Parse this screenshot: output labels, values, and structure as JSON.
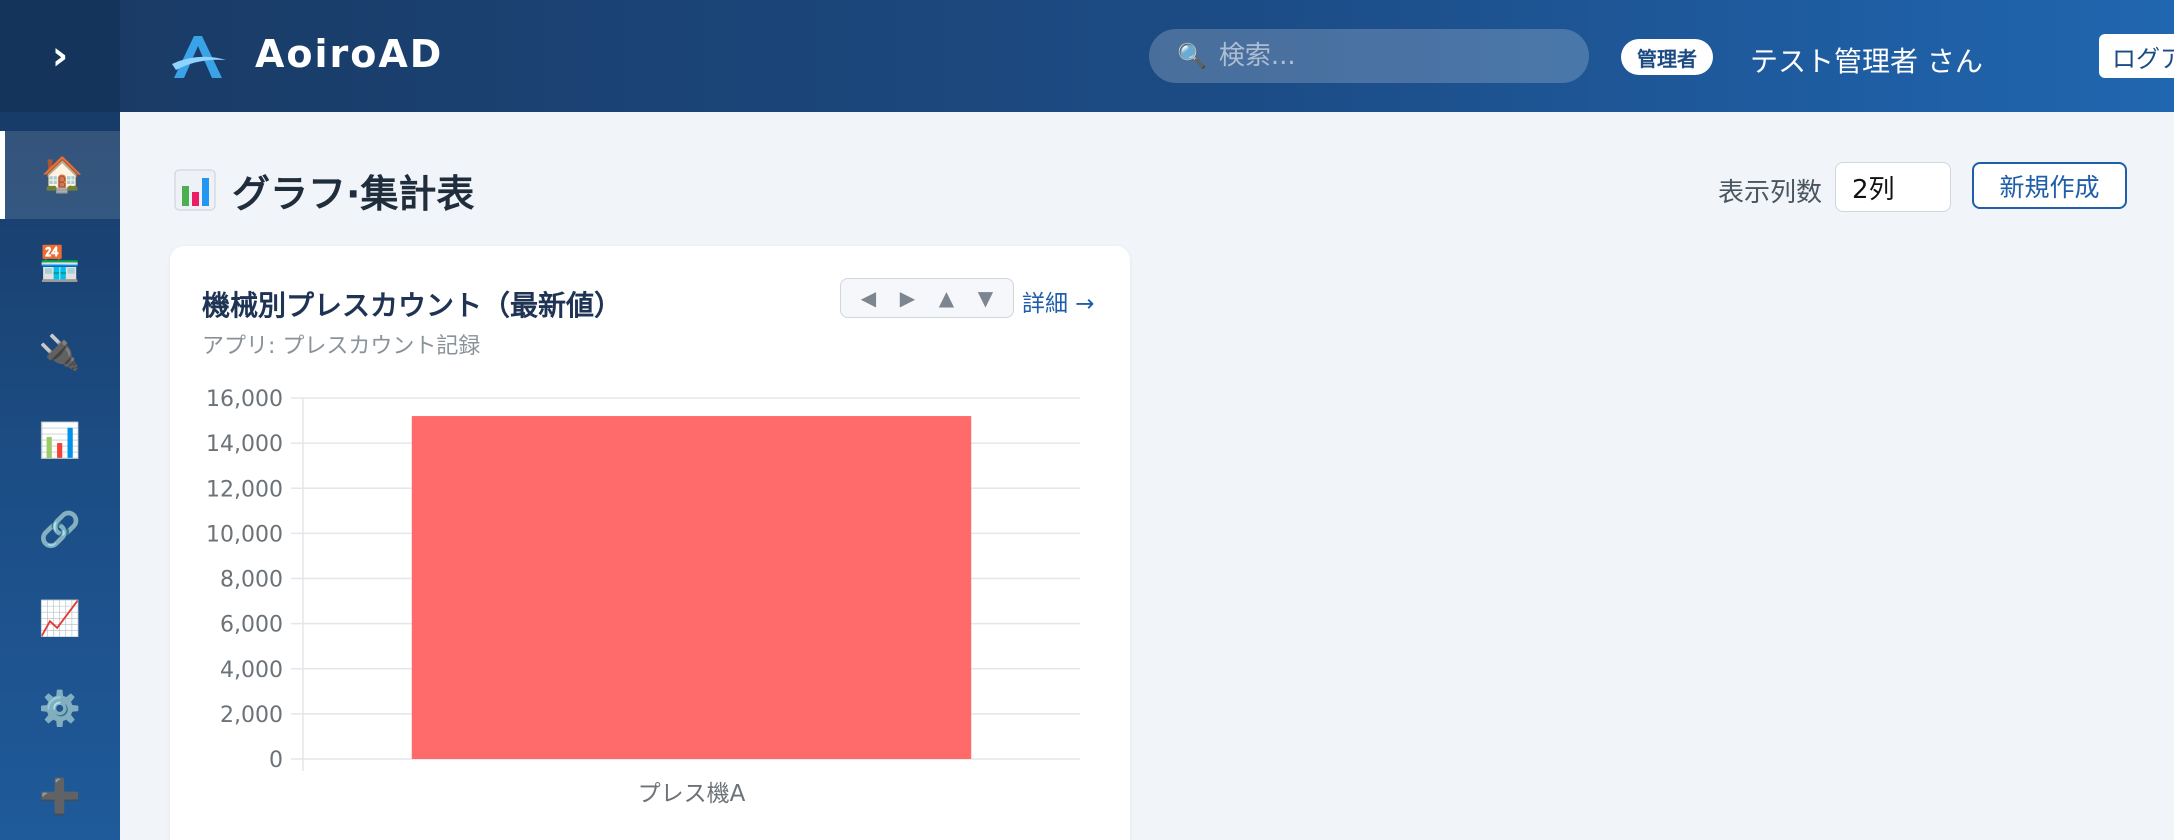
{
  "app": {
    "name": "AoiroAD"
  },
  "sidebar": {
    "toggle": "›",
    "items": [
      {
        "icon": "🏠",
        "name": "home",
        "active": true
      },
      {
        "icon": "🏪",
        "name": "store",
        "active": false
      },
      {
        "icon": "🔌",
        "name": "plug",
        "active": false
      },
      {
        "icon": "📊",
        "name": "bar-chart",
        "active": false
      },
      {
        "icon": "🔗",
        "name": "link",
        "active": false
      },
      {
        "icon": "📈",
        "name": "trend-chart",
        "active": false
      },
      {
        "icon": "⚙️",
        "name": "gear",
        "active": false
      },
      {
        "icon": "➕",
        "name": "plus",
        "active": false
      }
    ]
  },
  "header": {
    "search_icon": "🔍",
    "search_placeholder": "検索...",
    "role_badge": "管理者",
    "user_name": "テスト管理者 さん",
    "logout_label": "ログアウト"
  },
  "page": {
    "title": "グラフ·集計表",
    "columns_label": "表示列数",
    "columns_value": "2列",
    "new_button": "新規作成"
  },
  "card": {
    "title": "機械別プレスカウント（最新値）",
    "subtitle": "アプリ: プレスカウント記録",
    "controls": [
      "◀",
      "▶",
      "▲",
      "▼"
    ],
    "detail_link": "詳細 →"
  },
  "chart_data": {
    "type": "bar",
    "categories": [
      "プレス機A"
    ],
    "values": [
      15200
    ],
    "ylim": [
      0,
      16000
    ],
    "yticks": [
      0,
      2000,
      4000,
      6000,
      8000,
      10000,
      12000,
      14000,
      16000
    ],
    "ytick_labels": [
      "0",
      "2,000",
      "4,000",
      "6,000",
      "8,000",
      "10,000",
      "12,000",
      "14,000",
      "16,000"
    ],
    "grid": true,
    "bar_color": "#ff6b6b"
  }
}
